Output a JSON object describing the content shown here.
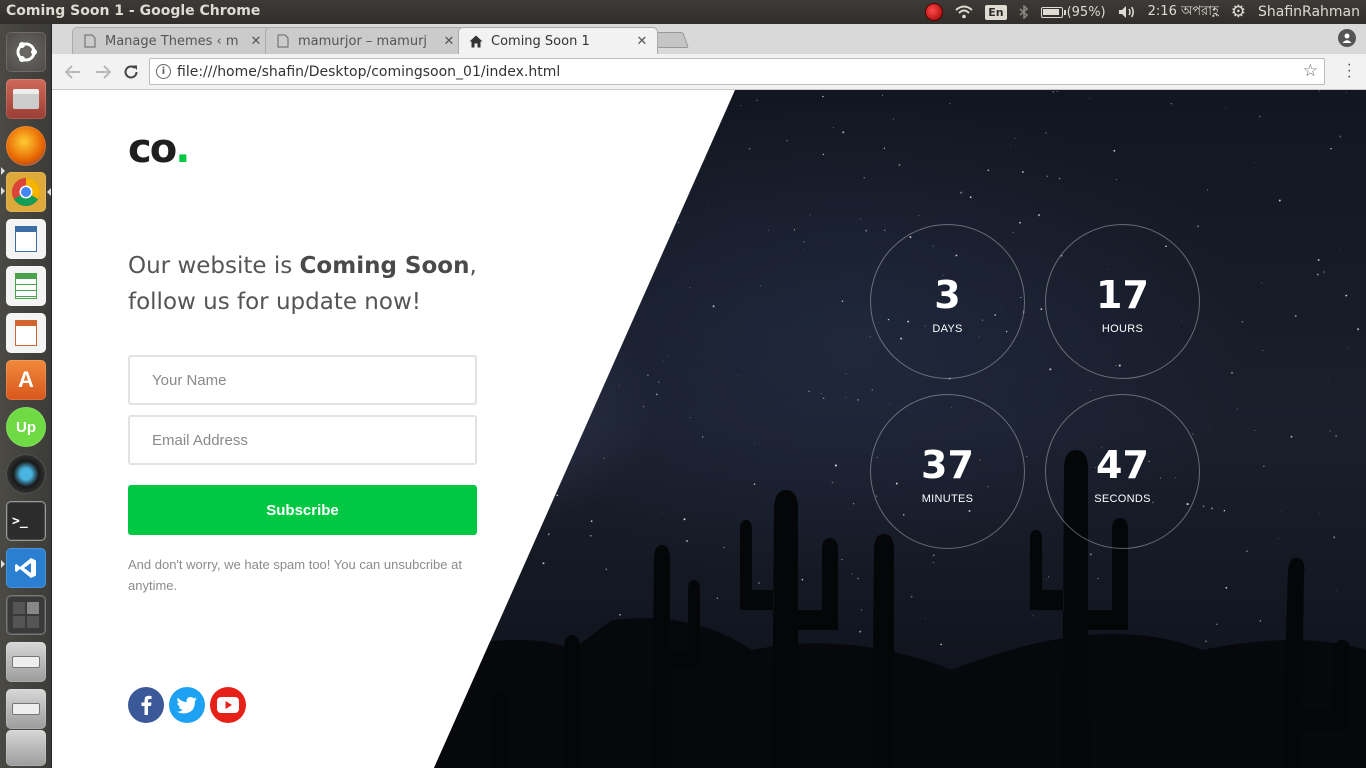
{
  "system": {
    "window_title": "Coming Soon 1 - Google Chrome",
    "battery": "(95%)",
    "battery_level": 0.95,
    "time": "2:16 অপরাহ্ণ",
    "user": "ShafinRahman",
    "keyboard": "En"
  },
  "launcher": {
    "items": [
      "ubuntu-dash",
      "files",
      "firefox",
      "chrome",
      "libreoffice-writer",
      "libreoffice-calc",
      "libreoffice-impress",
      "software-center",
      "upwork",
      "camera",
      "terminal",
      "vscode",
      "workspaces",
      "drive-1",
      "drive-2",
      "trash"
    ]
  },
  "browser": {
    "tabs": [
      {
        "label": "Manage Themes ‹ m",
        "icon": "page-icon",
        "active": false
      },
      {
        "label": "mamurjor – mamurj",
        "icon": "page-icon",
        "active": false
      },
      {
        "label": "Coming Soon 1",
        "icon": "home-icon",
        "active": true
      }
    ],
    "close_glyph": "✕",
    "url": "file:///home/shafin/Desktop/comingsoon_01/index.html"
  },
  "page": {
    "logo_text": "co",
    "logo_dot": ".",
    "headline_pre": "Our website is ",
    "headline_bold": "Coming Soon",
    "headline_post": ",",
    "headline_line2": "follow us for update now!",
    "name_placeholder": "Your Name",
    "email_placeholder": "Email Address",
    "subscribe_label": "Subscribe",
    "note": "And don't worry, we hate spam too! You can unsubcribe at anytime.",
    "social": [
      {
        "name": "facebook",
        "color": "#3b5998"
      },
      {
        "name": "twitter",
        "color": "#1da1f2"
      },
      {
        "name": "youtube",
        "color": "#e62117"
      }
    ],
    "accent_color": "#00c843",
    "countdown": [
      {
        "value": "3",
        "unit": "Days"
      },
      {
        "value": "17",
        "unit": "Hours"
      },
      {
        "value": "37",
        "unit": "Minutes"
      },
      {
        "value": "47",
        "unit": "Seconds"
      }
    ]
  }
}
